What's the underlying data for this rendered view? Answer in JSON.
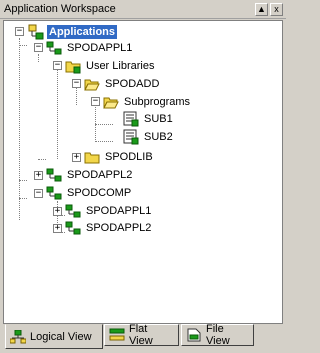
{
  "window": {
    "title": "Application Workspace",
    "pin_glyph": "▲",
    "close_glyph": "x"
  },
  "tree": {
    "root": "Applications",
    "nodes": {
      "spodappl1": "SPODAPPL1",
      "user_libraries": "User Libraries",
      "spodadd": "SPODADD",
      "subprograms": "Subprograms",
      "sub1": "SUB1",
      "sub2": "SUB2",
      "spodlib": "SPODLIB",
      "spodappl2": "SPODAPPL2",
      "spodcomp": "SPODCOMP",
      "spodcomp_appl1": "SPODAPPL1",
      "spodcomp_appl2": "SPODAPPL2"
    }
  },
  "tabs": {
    "logical": "Logical View",
    "flat": "Flat View",
    "file": "File View"
  },
  "colors": {
    "selection": "#316ac5",
    "green": "#1a9a1a",
    "folder": "#f2d64a"
  }
}
